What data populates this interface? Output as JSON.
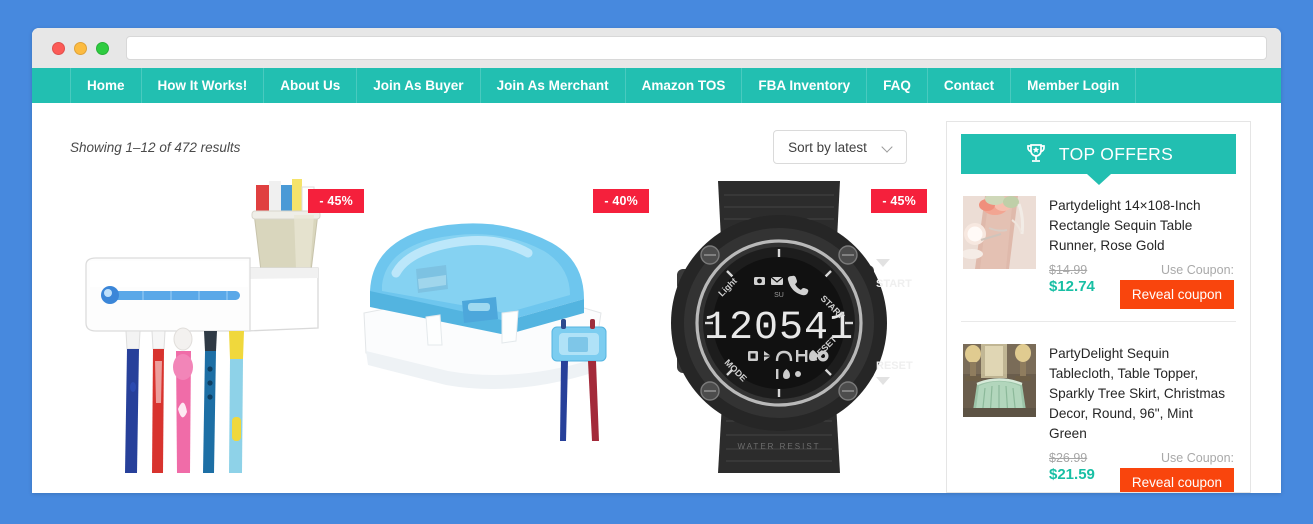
{
  "browser": {
    "url_value": "",
    "url_placeholder": "",
    "traffic_lights": [
      "close-red",
      "minimize-yellow",
      "maximize-green"
    ]
  },
  "nav": {
    "items": [
      {
        "label": "Home"
      },
      {
        "label": "How It Works!"
      },
      {
        "label": "About Us"
      },
      {
        "label": "Join As Buyer"
      },
      {
        "label": "Join As Merchant"
      },
      {
        "label": "Amazon TOS"
      },
      {
        "label": "FBA Inventory"
      },
      {
        "label": "FAQ"
      },
      {
        "label": "Contact"
      },
      {
        "label": "Member Login"
      }
    ]
  },
  "shop": {
    "showing_text": "Showing 1–12 of 472 results",
    "sort_label": "Sort by latest",
    "sort_options": [
      "Sort by latest"
    ],
    "products": [
      {
        "name": "uv-toothbrush-sanitizer",
        "discount_badge": "- 45%"
      },
      {
        "name": "uv-sterilizer-box",
        "discount_badge": "- 40%"
      },
      {
        "name": "digital-sport-watch",
        "discount_badge": "- 45%",
        "watch_display": "120541"
      }
    ]
  },
  "sidebar": {
    "header_title": "TOP OFFERS",
    "header_icon": "trophy-icon",
    "offers": [
      {
        "title": "Partydelight 14×108-Inch Rectangle Sequin Table Runner, Rose Gold",
        "old_price": "$14.99",
        "new_price": "$12.74",
        "use_coupon_label": "Use Coupon:",
        "reveal_label": "Reveal coupon"
      },
      {
        "title": "PartyDelight Sequin Tablecloth, Table Topper, Sparkly Tree Skirt, Christmas Decor, Round, 96\", Mint Green",
        "old_price": "$26.99",
        "new_price": "$21.59",
        "use_coupon_label": "Use Coupon:",
        "reveal_label": "Reveal coupon"
      }
    ]
  },
  "colors": {
    "page_background": "#4789de",
    "nav_teal": "#22bfb1",
    "badge_red": "#f5203c",
    "coupon_orange": "#f9450d",
    "price_teal": "#18bfa4",
    "titlebar_gray": "#e7e7e7"
  }
}
